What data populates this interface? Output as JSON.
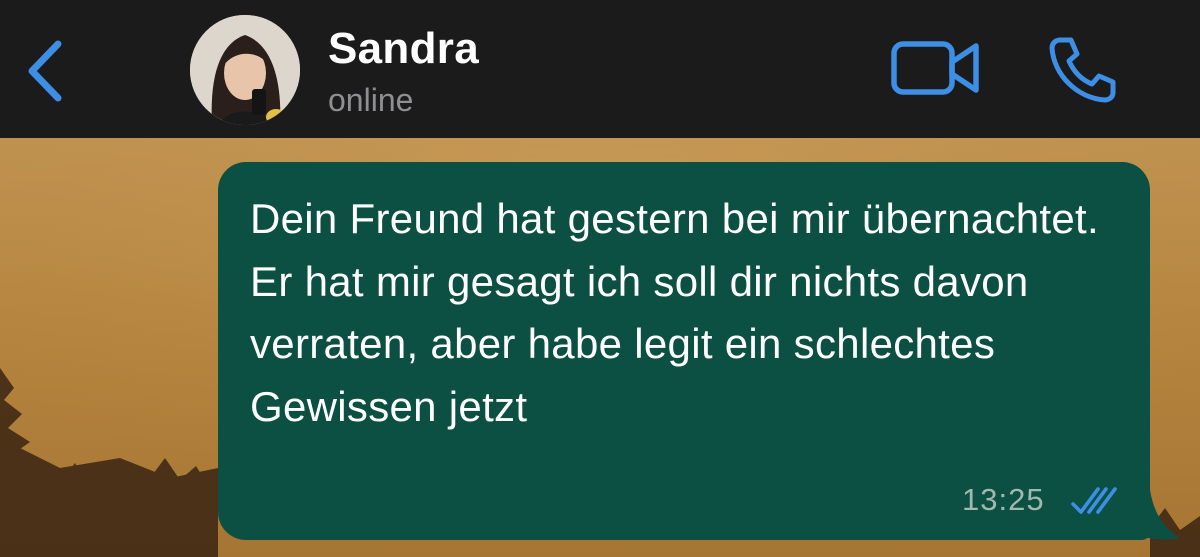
{
  "header": {
    "contact_name": "Sandra",
    "status": "online",
    "back_icon": "chevron-left-icon",
    "video_icon": "video-camera-icon",
    "call_icon": "phone-icon"
  },
  "message": {
    "direction": "outgoing",
    "text": "Dein Freund hat gestern bei mir übernachtet. Er hat mir gesagt ich soll dir nichts davon verraten, aber habe legit ein schlechtes Gewissen jetzt",
    "time": "13:25",
    "receipt_icon": "double-check-icon"
  },
  "colors": {
    "header_bg": "#1b1b1b",
    "accent": "#3d8fe6",
    "bubble_bg": "#0c4f43",
    "status_text": "#8e8e93",
    "time_text": "#9fb8b1",
    "wallpaper": "#b98a4a"
  }
}
